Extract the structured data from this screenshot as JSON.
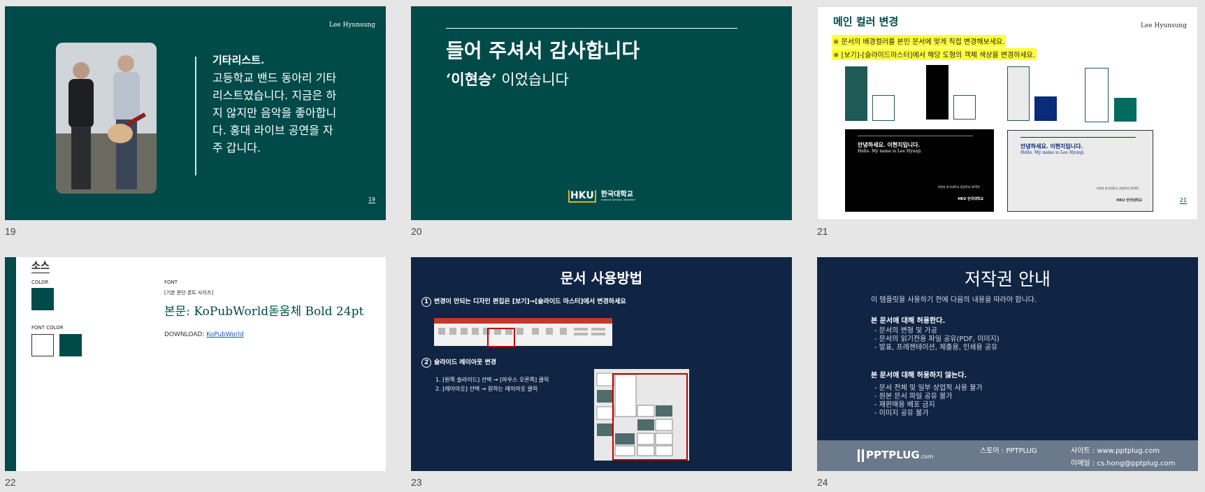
{
  "slide_numbers": [
    "19",
    "20",
    "21",
    "22",
    "23",
    "24"
  ],
  "s19": {
    "author": "Lee Hyunsung",
    "caption_head": "기타리스트.",
    "caption_body": "고등학교 밴드 동아리 기타리스트였습니다. 지금은 하지 않지만 음악을 좋아합니다. 홍대 라이브 공연을 자주 갑니다.",
    "page": "19"
  },
  "s20": {
    "line1": "들어 주셔서 감사합니다",
    "name": "‘이현승’",
    "line2_rest": " 이었습니다",
    "logo_mark": "HKU",
    "logo_name": "한국대학교",
    "logo_sub": "HANKOOK NATIONAL UNIVERSITY"
  },
  "s21": {
    "title": "메인 컬러 변경",
    "author": "Lee Hyunsung",
    "notes": [
      "※ 문서의 배경컬러를 본인 문서에 맞게 직접 변경해보세요.",
      "※ [보기]-[슬라이드마스터]에서 해당 도형의 객체 색상을 변경하세요."
    ],
    "card_line1": "안녕하세요. 이현지입니다.",
    "card_line2": "Hello. My name is Lee Hyunji.",
    "card_sig": "이현지 한국대학교 경영학과 24학번",
    "card_logo": "HKU 한국대학교",
    "page": "21",
    "colors": {
      "teal": "#1e5a56",
      "black": "#000000",
      "light": "#ebebeb",
      "navy": "#0a2a7a",
      "green": "#006b5f"
    }
  },
  "s22": {
    "title": "소스",
    "color_label": "COLOR",
    "font_color_label": "FONT COLOR",
    "font_label": "FONT",
    "font_sub": "[기본 문단 폰트 사이즈]",
    "font_name": "본문: KoPubWorld돋움체 Bold 24pt",
    "download_label": "DOWNLOAD:",
    "download_link": "KoPubWorld",
    "main_color": "#004a4a"
  },
  "s23": {
    "title": "문서 사용방법",
    "step1_num": "1",
    "step1": "변경이 안되는 디자인 편집은 [보기]→[슬라이드 마스터]에서 변경하세요",
    "step2_num": "2",
    "step2": "슬라이드 레이아웃 변경",
    "items": [
      "1. [왼쪽 슬라이드] 선택 → [마우스 오른쪽] 클릭",
      "2. [레이아웃] 선택 → 원하는 레이아웃 클릭"
    ]
  },
  "s24": {
    "title": "저작권 안내",
    "intro": "이 템플릿을 사용하기 전에 다음의 내용을 따라야 합니다.",
    "allowed_head": "본 문서에 대해 허용한다.",
    "allowed": [
      "-  문서의 변형 및 가공",
      "-  문서의 읽기전용 파일 공유(PDF, 이미지)",
      "-  발표, 프레젠테이션, 제출용, 인쇄용 공유"
    ],
    "denied_head": "본 문서에 대해 허용하지 않는다.",
    "denied": [
      "-  문서 전체 및 일부 상업적 사용 불가",
      "-  원본 문서 파일 공유 불가",
      "-  재판매용 배포 금지",
      "-  이미지 공유 불가"
    ],
    "brand": "PPTPLUG",
    "brand_suffix": ".com",
    "store": "스토어 : PPTPLUG",
    "site": "사이트 : www.pptplug.com",
    "email": "이메일 :  cs.hong@pptplug.com"
  }
}
